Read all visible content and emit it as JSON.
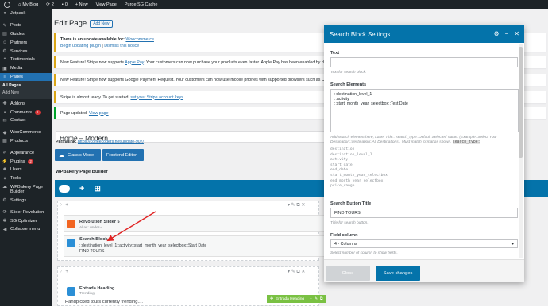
{
  "colors": {
    "admin_bg": "#1d2327",
    "accent": "#2271b1",
    "wpbakery_blue": "#0473aa",
    "annotation_red": "#e02424"
  },
  "adminbar": {
    "site": "My Blog",
    "updates": "2",
    "comments": "0",
    "new_label": "+ New",
    "view_page": "View Page",
    "purge": "Purge SG Cache"
  },
  "sidebar": {
    "items": [
      {
        "label": "Jetpack",
        "icon": "jetpack-icon"
      },
      {
        "label": "Posts",
        "icon": "pin-icon"
      },
      {
        "label": "Guides",
        "icon": "book-icon"
      },
      {
        "label": "Partners",
        "icon": "people-icon"
      },
      {
        "label": "Services",
        "icon": "gear-icon"
      },
      {
        "label": "Testimonials",
        "icon": "quote-icon"
      },
      {
        "label": "Media",
        "icon": "media-icon"
      },
      {
        "label": "Pages",
        "icon": "page-icon"
      }
    ],
    "pages_submenu": [
      "All Pages",
      "Add New"
    ],
    "items2": [
      {
        "label": "Addons",
        "icon": "addons-icon"
      },
      {
        "label": "Comments",
        "icon": "comment-icon",
        "badge": "1"
      },
      {
        "label": "Contact",
        "icon": "mail-icon"
      },
      {
        "label": "WooCommerce",
        "icon": "woo-icon"
      },
      {
        "label": "Products",
        "icon": "box-icon"
      },
      {
        "label": "Appearance",
        "icon": "brush-icon"
      },
      {
        "label": "Plugins",
        "icon": "plug-icon",
        "badge": "2"
      },
      {
        "label": "Users",
        "icon": "user-icon"
      },
      {
        "label": "Tools",
        "icon": "wrench-icon"
      },
      {
        "label": "WPBakery Page Builder",
        "icon": "wpb-icon"
      },
      {
        "label": "Settings",
        "icon": "settings-icon"
      },
      {
        "label": "Slider Revolution",
        "icon": "slider-icon"
      },
      {
        "label": "SG Optimizer",
        "icon": "sg-icon"
      },
      {
        "label": "Collapse menu",
        "icon": "collapse-icon"
      }
    ]
  },
  "page": {
    "title": "Edit Page",
    "add_new": "Add New",
    "notices": {
      "update_pre": "There is an update available for: ",
      "update_plugin": "Woocommerce",
      "update_link1": "Begin updating plugin",
      "update_sep": " | ",
      "update_link2": "Dismiss this notice",
      "applepay_text": "New Feature! Stripe now supports ",
      "applepay_link": "Apple Pay",
      "applepay_rest": ". Your customers can now purchase your products even faster. Apple Pay has been enabled by de",
      "googlepay": "New Feature! Stripe now supports Google Payment Request. Your customers can now use mobile phones with supported browsers such as Ch",
      "stripe_text": "Stripe is almost ready. To get started, ",
      "stripe_link": "set your Stripe account keys",
      "updated_text": "Page updated. ",
      "updated_link": "View page"
    },
    "post_title": "Home – Modern",
    "permalink_label": "Permalink:",
    "permalink_url": "https://coffeecoders.net/update-907/",
    "classic_mode": "Classic Mode",
    "frontend_editor": "Frontend Editor",
    "wpbakery_title": "WPBakery Page Builder"
  },
  "builder": {
    "rev_slider_name": "Revolution Slider 5",
    "rev_slider_sub": "Alias: under-4",
    "search_block_name": "Search Block",
    "search_block_line1": "::destination_level_1;:activity;:start_month_year_selectbox::Start Date",
    "search_block_line2": "FIND TOURS",
    "entrada_heading_name": "Entrada Heading",
    "entrada_heading_sub": "Trending",
    "entrada_heading_text": "Handpicked tours currently trending....",
    "green_bar_label": "Entrada Heading"
  },
  "modal": {
    "title": "Search Block Settings",
    "text_label": "Text",
    "text_value": "",
    "text_help": "Text for search block.",
    "elements_label": "Search Elements",
    "elements_value": "::destination_level_1\n::activity\n::start_month_year_selectbox::Test Date",
    "elements_help": "Add search element here, Label Title:: search_type::Default Selected Value. (Example: Select Your Destination::destination::All Destinations). Must match format as shown.",
    "search_type_key": "search_type:",
    "search_types": [
      "destination",
      "destination_level_1",
      "activity",
      "start_date",
      "end_date",
      "start_month_year_selectbox",
      "end_month_year_selectbox",
      "price_range"
    ],
    "button_title_label": "Search Button Title",
    "button_title_value": "FIND TOURS",
    "button_title_help": "Title for search button.",
    "field_column_label": "Field column",
    "field_column_value": "4 - Columns",
    "field_column_help": "Select number of column to show fields.",
    "close_button": "Close",
    "save_button": "Save changes"
  }
}
